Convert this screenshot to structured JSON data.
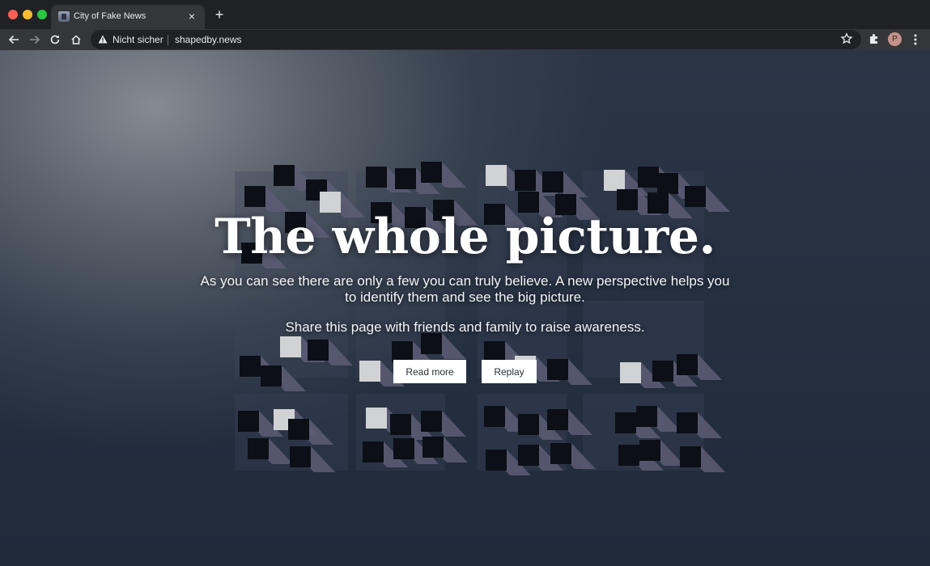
{
  "browser": {
    "tab_title": "City of Fake News",
    "tab_close": "×",
    "new_tab": "+",
    "security_label": "Nicht sicher",
    "url": "shapedby.news",
    "profile_initial": "P"
  },
  "hero": {
    "headline": "The whole picture.",
    "lead": "As you can see there are only a few you can truly believe. A new perspective helps you to identify them and see the big picture.",
    "share": "Share this page with friends and family to raise awareness.",
    "read_more": "Read more",
    "replay": "Replay"
  },
  "colors": {
    "accent_white": "#ffffff",
    "pillar": "#5d5d76",
    "pillar_top_dark": "#0c0f16",
    "pillar_top_light": "#d0d2d4",
    "page_bg": "#1e2838"
  },
  "icons": [
    "back-arrow-icon",
    "forward-arrow-icon",
    "reload-icon",
    "home-icon",
    "warning-icon",
    "star-icon",
    "extensions-icon",
    "kebab-menu-icon"
  ]
}
